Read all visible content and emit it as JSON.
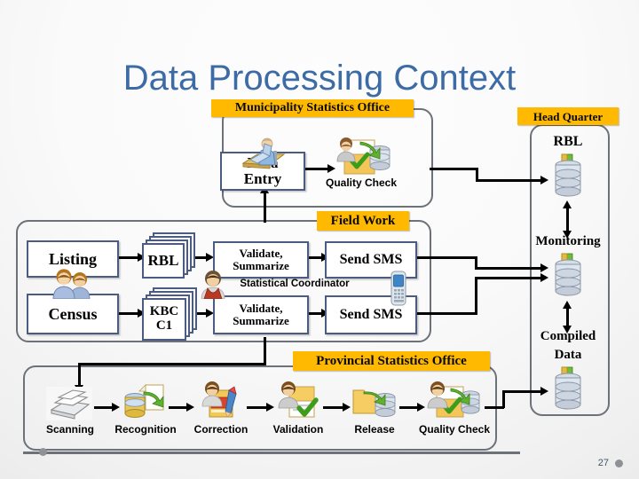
{
  "slide": {
    "title": "Data Processing Context",
    "page_number": "27",
    "title_color": "#3c6ba6",
    "banner_color": "#ffb900",
    "box_border_color": "#4a5c82",
    "group_border_color": "#6d7278"
  },
  "groups": {
    "municipality": {
      "banner": "Municipality Statistics Office"
    },
    "field_work": {
      "banner": "Field Work"
    },
    "provincial": {
      "banner": "Provincial Statistics Office"
    },
    "head_quarter": {
      "banner": "Head Quarter"
    }
  },
  "municipality": {
    "data_entry_line1": "Data",
    "data_entry_line2": "Entry",
    "quality_check": "Quality Check",
    "icons": {
      "data_entry": "person-at-desk-icon",
      "quality_check": "user-document-check-database-icon"
    }
  },
  "field_work": {
    "row1": {
      "source": "Listing",
      "register_line1": "RBL",
      "register_line2": "",
      "validate_line1": "Validate,",
      "validate_line2": "Summarize",
      "send": "Send SMS"
    },
    "row2": {
      "source": "Census",
      "register_line1": "KBC",
      "register_line2": "C1",
      "validate_line1": "Validate,",
      "validate_line2": "Summarize",
      "send": "Send SMS"
    },
    "coordinator_label": "Statistical  Coordinator",
    "icons": {
      "sources": "two-users-icon",
      "coordinator": "user-coordinator-icon",
      "sms": "mobile-phone-icon"
    }
  },
  "provincial": {
    "steps": [
      {
        "label": "Scanning",
        "icon": "scanner-icon"
      },
      {
        "label": "Recognition",
        "icon": "database-to-document-icon"
      },
      {
        "label": "Correction",
        "icon": "user-pencil-form-icon"
      },
      {
        "label": "Validation",
        "icon": "user-document-check-icon"
      },
      {
        "label": "Release",
        "icon": "folder-arrow-database-icon"
      },
      {
        "label": "Quality Check",
        "icon": "user-document-check-database-icon"
      }
    ]
  },
  "head_quarter": {
    "nodes": [
      {
        "label": "RBL",
        "icon": "database-icon"
      },
      {
        "label": "Monitoring",
        "icon": "database-icon"
      },
      {
        "label": "Compiled Data",
        "icon": "database-icon"
      }
    ],
    "compiled_line1": "Compiled",
    "compiled_line2": "Data"
  }
}
